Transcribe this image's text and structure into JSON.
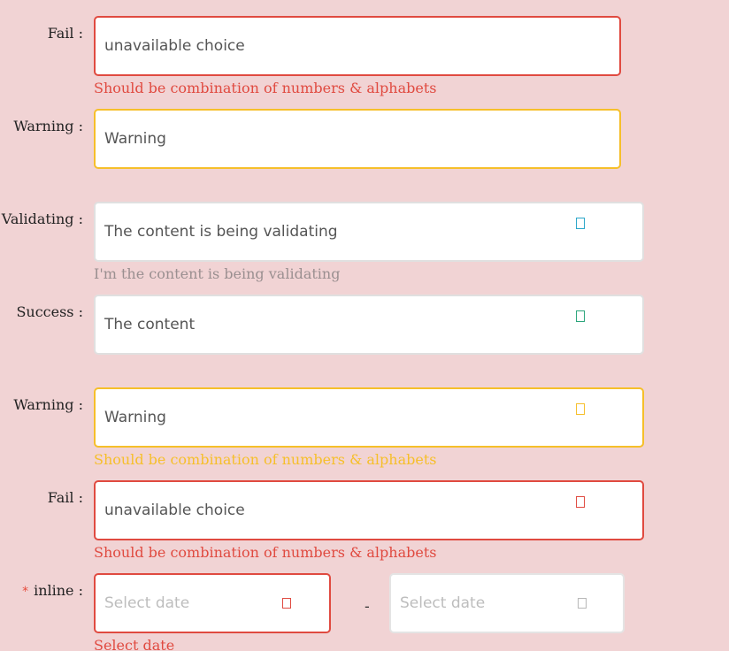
{
  "rows": [
    {
      "label": "Fail :",
      "value": "unavailable choice",
      "help": "Should be combination of numbers & alphabets"
    },
    {
      "label": "Warning :",
      "value": "Warning"
    },
    {
      "label": "Validating :",
      "value": "The content is being validating",
      "help": "I'm the content is being validating",
      "icon": "validating-icon"
    },
    {
      "label": "Success :",
      "value": "The content",
      "icon": "success-icon"
    },
    {
      "label": "Warning :",
      "value": "Warning",
      "help": "Should be combination of numbers & alphabets",
      "icon": "warning-icon"
    },
    {
      "label": "Fail :",
      "value": "unavailable choice",
      "help": "Should be combination of numbers & alphabets",
      "icon": "error-icon"
    }
  ],
  "inline": {
    "required_mark": "*",
    "label": "inline :",
    "start_placeholder": "Select date",
    "separator": "-",
    "end_placeholder": "Select date",
    "help": "Select date"
  },
  "colors": {
    "background": "#f1d3d4",
    "error": "#e04a40",
    "warning": "#f6bf2a",
    "validating": "#2aa6c9",
    "success": "#2ba57b"
  }
}
